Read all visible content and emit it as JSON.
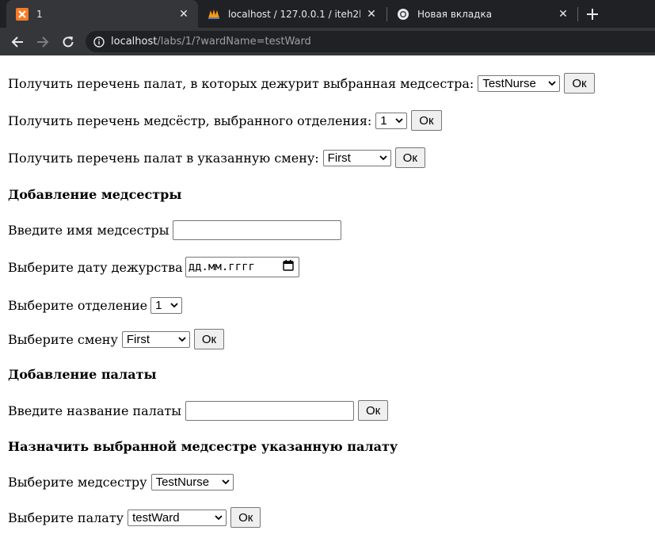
{
  "browser": {
    "tabs": [
      {
        "title": "1",
        "favicon": "xampp-icon",
        "active": true
      },
      {
        "title": "localhost / 127.0.0.1 / iteh2lb1var",
        "favicon": "phpmyadmin-icon",
        "active": false
      },
      {
        "title": "Новая вкладка",
        "favicon": "chrome-icon",
        "active": false
      }
    ],
    "url_host": "localhost",
    "url_path": "/labs/1/?wardName=testWard"
  },
  "form": {
    "q1": {
      "label": "Получить перечень палат, в которых дежурит выбранная медсестра:",
      "select": "TestNurse",
      "button": "Ок"
    },
    "q2": {
      "label": "Получить перечень медсёстр, выбранного отделения:",
      "select": "1",
      "button": "Ок"
    },
    "q3": {
      "label": "Получить перечень палат в указанную смену:",
      "select": "First",
      "button": "Ок"
    },
    "add_nurse": {
      "heading": "Добавление медсестры",
      "name_label": "Введите имя медсестры",
      "name_value": "",
      "date_label": "Выберите дату дежурства",
      "date_placeholder": "дд.мм.гггг",
      "dept_label": "Выберите отделение",
      "dept_select": "1",
      "shift_label": "Выберите смену",
      "shift_select": "First",
      "button": "Ок"
    },
    "add_ward": {
      "heading": "Добавление палаты",
      "name_label": "Введите название палаты",
      "name_value": "",
      "button": "Ок"
    },
    "assign": {
      "heading": "Назначить выбранной медсестре указанную палату",
      "nurse_label": "Выберите медсестру",
      "nurse_select": "TestNurse",
      "ward_label": "Выберите палату",
      "ward_select": "testWard",
      "button": "Ок"
    }
  }
}
